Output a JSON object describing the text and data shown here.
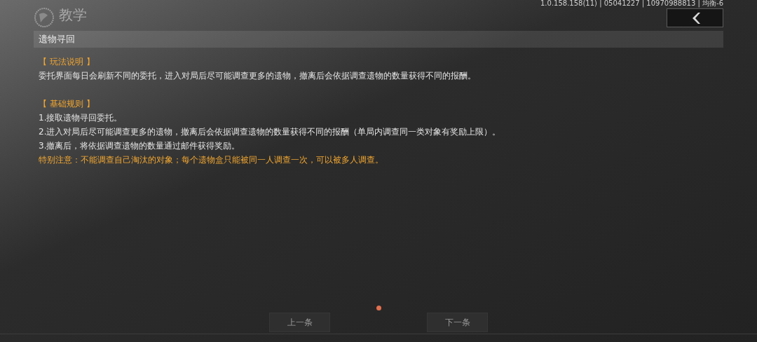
{
  "header": {
    "title": "教学",
    "version": "1.0.158.158(11) | 05041227 | 10970988813 | 均衡-6"
  },
  "page_title": "遗物寻回",
  "sections": [
    {
      "heading": "【 玩法说明 】",
      "lines": [
        {
          "kind": "normal",
          "text": "委托界面每日会刷新不同的委托，进入对局后尽可能调查更多的遗物，撤离后会依据调查遗物的数量获得不同的报酬。"
        }
      ]
    },
    {
      "heading": "【 基础规则 】",
      "lines": [
        {
          "kind": "normal",
          "text": "1.接取遗物寻回委托。"
        },
        {
          "kind": "normal",
          "text": "2.进入对局后尽可能调查更多的遗物，撤离后会依据调查遗物的数量获得不同的报酬（单局内调查同一类对象有奖励上限）。"
        },
        {
          "kind": "normal",
          "text": "3.撤离后，将依据调查遗物的数量通过邮件获得奖励。"
        },
        {
          "kind": "warning",
          "text": "特别注意：不能调查自己淘汰的对象；每个遗物盒只能被同一人调查一次，可以被多人调查。"
        }
      ]
    }
  ],
  "pager": [
    {
      "selected": true
    }
  ],
  "buttons": [
    "上一条",
    "下一条"
  ]
}
